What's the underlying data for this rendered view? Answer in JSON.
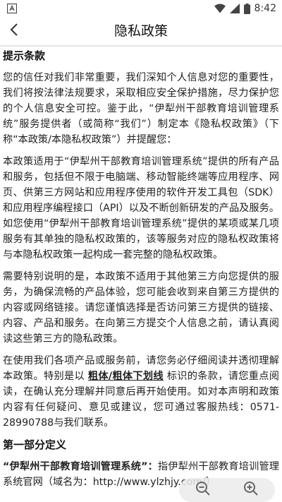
{
  "status_bar": {
    "time": "8:42"
  },
  "nav": {
    "title": "隐私政策"
  },
  "sections": {
    "intro_heading": "提示条款",
    "p1": "您的信任对我们非常重要，我们深知个人信息对您的重要性，我们将按法律法规要求，采取相应安全保护措施，尽力保护您的个人信息安全可控。鉴于此，“伊犁州干部教育培训管理系统”服务提供者（或简称“我们”）制定本《隐私权政策》（下称“本政策/本隐私权政策”）并提醒您：",
    "p2": "本政策适用于“伊犁州干部教育培训管理系统”提供的所有产品和服务，包括但不限于电脑端、移动智能终端等应用程序、网页、供第三方网站和应用程序使用的软件开发工具包（SDK）和应用程序编程接口（API）以及不断创新研发的产品及服务。如您使用“伊犁州干部教育培训管理系统”提供的某项或某几项服务有其单独的隐私权政策的，该等服务对应的隐私权政策将与本隐私权政策一起构成一套完整的隐私权政策。",
    "p3": "需要特别说明的是，本政策不适用于其他第三方向您提供的服务，为确保流畅的产品体验，您可能会收到来自第三方提供的内容或网络链接。请您谨慎选择是否访问第三方提供的链接、内容、产品和服务。在向第三方提交个人信息之前，请认真阅读这些第三方的隐私政策。",
    "p4_before": "在使用我们各项产品或服务前，请您务必仔细阅读并透彻理解本政策。特别是以 ",
    "p4_emphasis": "粗体/粗体下划线",
    "p4_after": " 标识的条款，请您重点阅读，在确认充分理解并同意后再开始使用。如对本声明和政策内容有任何疑问、意见或建议，您可通过客服热线：0571-28990788与我们联系。",
    "part1_heading": "第一部分定义",
    "def_term": "“伊犁州干部教育培训管理系统”：",
    "def_text": "指伊犁州干部教育培训管理系统官网（域名为：http://www.ylzhjy.com/）"
  },
  "zoom": {
    "out_icon": "zoom-out-icon",
    "in_icon": "zoom-in-icon"
  }
}
